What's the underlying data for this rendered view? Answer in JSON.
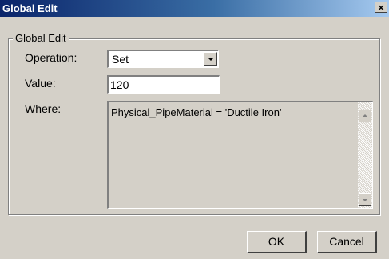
{
  "window": {
    "title": "Global Edit",
    "close_glyph": "×"
  },
  "group": {
    "label": "Global Edit"
  },
  "form": {
    "operation_label": "Operation:",
    "operation_value": "Set",
    "value_label": "Value:",
    "value_text": "120",
    "where_label": "Where:",
    "where_text": "Physical_PipeMaterial = 'Ductile Iron'"
  },
  "buttons": {
    "ok": "OK",
    "cancel": "Cancel"
  },
  "colors": {
    "titlebar_start": "#0a246a",
    "titlebar_end": "#a6caf0",
    "dialog_bg": "#d4d0c8"
  }
}
